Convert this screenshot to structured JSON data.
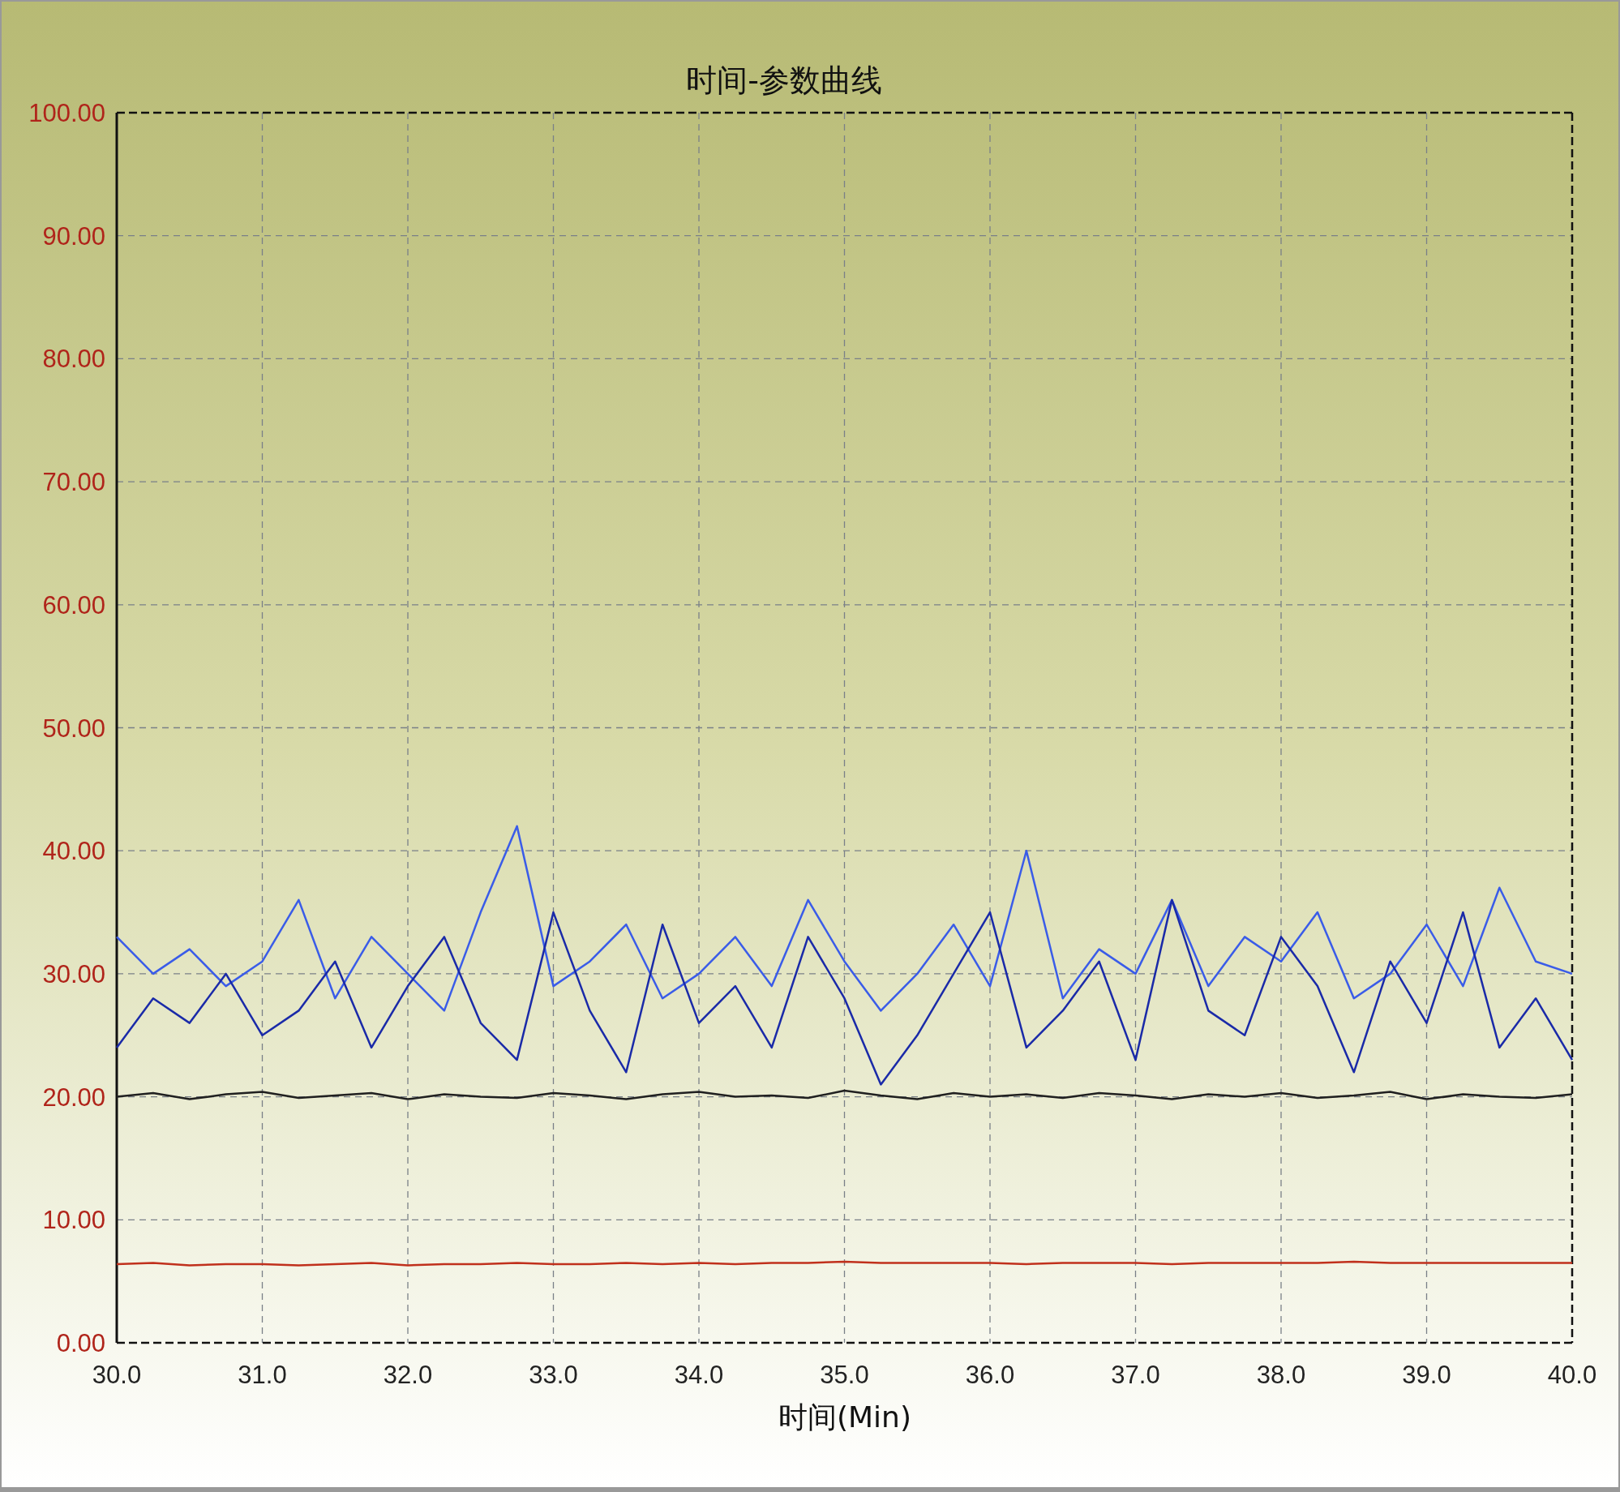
{
  "chart": {
    "chart_data": {
      "type": "line",
      "title": "时间-参数曲线",
      "xlabel": "时间(Min)",
      "x": [
        30,
        30.25,
        30.5,
        30.75,
        31,
        31.25,
        31.5,
        31.75,
        32,
        32.25,
        32.5,
        32.75,
        33,
        33.25,
        33.5,
        33.75,
        34,
        34.25,
        34.5,
        34.75,
        35,
        35.25,
        35.5,
        35.75,
        36,
        36.25,
        36.5,
        36.75,
        37,
        37.25,
        37.5,
        37.75,
        38,
        38.25,
        38.5,
        38.75,
        39,
        39.25,
        39.5,
        39.75,
        40
      ],
      "series": [
        {
          "color": "#3a5ce8",
          "values": [
            33,
            30,
            32,
            29,
            31,
            36,
            28,
            33,
            30,
            27,
            35,
            42,
            29,
            31,
            34,
            28,
            30,
            33,
            29,
            36,
            31,
            27,
            30,
            34,
            29,
            40,
            28,
            32,
            30,
            36,
            29,
            33,
            31,
            35,
            28,
            30,
            34,
            29,
            37,
            31,
            30
          ]
        },
        {
          "color": "#1a2aa8",
          "values": [
            24,
            28,
            26,
            30,
            25,
            27,
            31,
            24,
            29,
            33,
            26,
            23,
            35,
            27,
            22,
            34,
            26,
            29,
            24,
            33,
            28,
            21,
            25,
            30,
            35,
            24,
            27,
            31,
            23,
            36,
            27,
            25,
            33,
            29,
            22,
            31,
            26,
            35,
            24,
            28,
            23
          ]
        },
        {
          "color": "#202020",
          "values": [
            20,
            20.3,
            19.8,
            20.2,
            20.4,
            19.9,
            20.1,
            20.3,
            19.8,
            20.2,
            20,
            19.9,
            20.3,
            20.1,
            19.8,
            20.2,
            20.4,
            20,
            20.1,
            19.9,
            20.5,
            20.1,
            19.8,
            20.3,
            20,
            20.2,
            19.9,
            20.3,
            20.1,
            19.8,
            20.2,
            20,
            20.3,
            19.9,
            20.1,
            20.4,
            19.8,
            20.2,
            20,
            19.9,
            20.2
          ]
        },
        {
          "color": "#c0301c",
          "values": [
            6.4,
            6.5,
            6.3,
            6.4,
            6.4,
            6.3,
            6.4,
            6.5,
            6.3,
            6.4,
            6.4,
            6.5,
            6.4,
            6.4,
            6.5,
            6.4,
            6.5,
            6.4,
            6.5,
            6.5,
            6.6,
            6.5,
            6.5,
            6.5,
            6.5,
            6.4,
            6.5,
            6.5,
            6.5,
            6.4,
            6.5,
            6.5,
            6.5,
            6.5,
            6.6,
            6.5,
            6.5,
            6.5,
            6.5,
            6.5,
            6.5
          ]
        }
      ],
      "grid": true,
      "xlim": [
        30,
        40
      ],
      "ylim": [
        0,
        100
      ],
      "xticks": [
        {
          "value": 30,
          "label": "30.0"
        },
        {
          "value": 31,
          "label": "31.0"
        },
        {
          "value": 32,
          "label": "32.0"
        },
        {
          "value": 33,
          "label": "33.0"
        },
        {
          "value": 34,
          "label": "34.0"
        },
        {
          "value": 35,
          "label": "35.0"
        },
        {
          "value": 36,
          "label": "36.0"
        },
        {
          "value": 37,
          "label": "37.0"
        },
        {
          "value": 38,
          "label": "38.0"
        },
        {
          "value": 39,
          "label": "39.0"
        },
        {
          "value": 40,
          "label": "40.0"
        }
      ],
      "yticks": [
        {
          "value": 0,
          "label": "0.00"
        },
        {
          "value": 10,
          "label": "10.00"
        },
        {
          "value": 20,
          "label": "20.00"
        },
        {
          "value": 30,
          "label": "30.00"
        },
        {
          "value": 40,
          "label": "40.00"
        },
        {
          "value": 50,
          "label": "50.00"
        },
        {
          "value": 60,
          "label": "60.00"
        },
        {
          "value": 70,
          "label": "70.00"
        },
        {
          "value": 80,
          "label": "80.00"
        },
        {
          "value": 90,
          "label": "90.00"
        },
        {
          "value": 100,
          "label": "100.00"
        }
      ]
    }
  }
}
